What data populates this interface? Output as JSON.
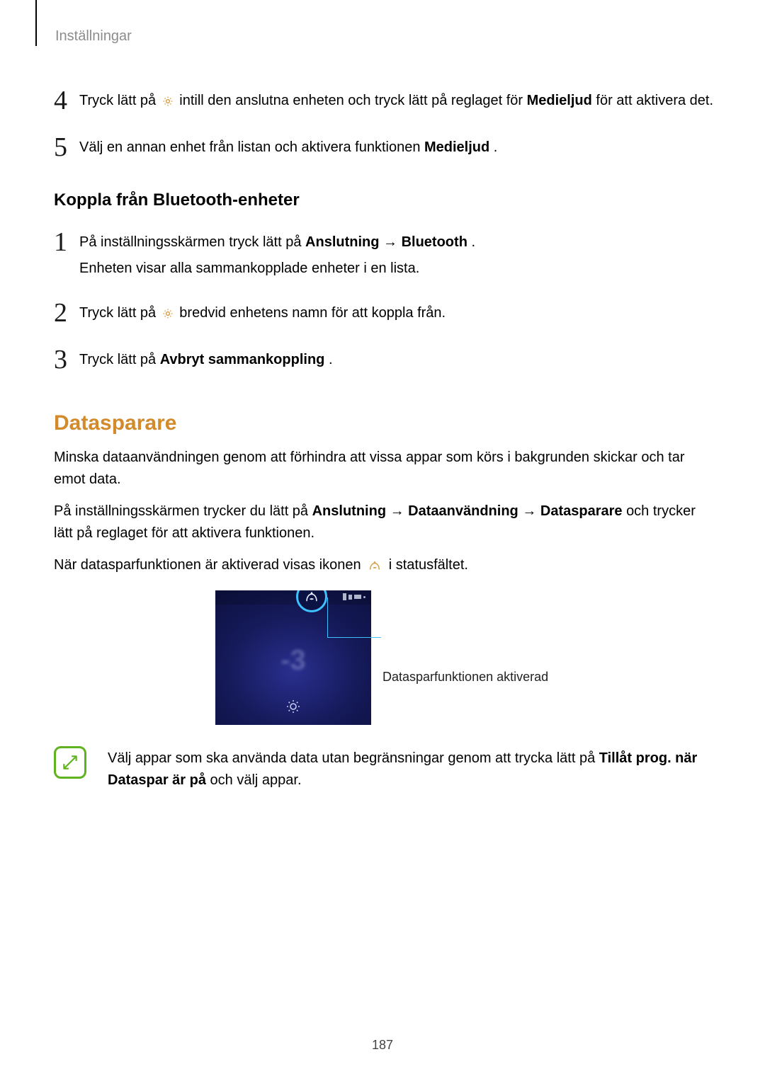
{
  "header": "Inställningar",
  "steps_a": {
    "s4": {
      "num": "4",
      "t1": "Tryck lätt på ",
      "t2": " intill den anslutna enheten och tryck lätt på reglaget för ",
      "bold1": "Medieljud",
      "t3": " för att aktivera det."
    },
    "s5": {
      "num": "5",
      "t1": "Välj en annan enhet från listan och aktivera funktionen ",
      "bold1": "Medieljud",
      "t2": "."
    }
  },
  "subheading": "Koppla från Bluetooth-enheter",
  "steps_b": {
    "s1": {
      "num": "1",
      "t1": "På inställningsskärmen tryck lätt på ",
      "bold1": "Anslutning",
      "arrow1": " → ",
      "bold2": "Bluetooth",
      "t2": ".",
      "sub": "Enheten visar alla sammankopplade enheter i en lista."
    },
    "s2": {
      "num": "2",
      "t1": "Tryck lätt på ",
      "t2": " bredvid enhetens namn för att koppla från."
    },
    "s3": {
      "num": "3",
      "t1": "Tryck lätt på ",
      "bold1": "Avbryt sammankoppling",
      "t2": "."
    }
  },
  "h2": "Datasparare",
  "para1": "Minska dataanvändningen genom att förhindra att vissa appar som körs i bakgrunden skickar och tar emot data.",
  "para2": {
    "t1": "På inställningsskärmen trycker du lätt på ",
    "bold1": "Anslutning",
    "arrow1": " → ",
    "bold2": "Dataanvändning",
    "arrow2": " → ",
    "bold3": "Datasparare",
    "t2": " och trycker lätt på reglaget för att aktivera funktionen."
  },
  "para3": {
    "t1": "När datasparfunktionen är aktiverad visas ikonen ",
    "t2": " i statusfältet."
  },
  "callout": "Datasparfunktionen aktiverad",
  "figure_minus3": "-3",
  "note": {
    "t1": "Välj appar som ska använda data utan begränsningar genom att trycka lätt på ",
    "bold1": "Tillåt prog. när Dataspar är på",
    "t2": " och välj appar."
  },
  "page_number": "187"
}
